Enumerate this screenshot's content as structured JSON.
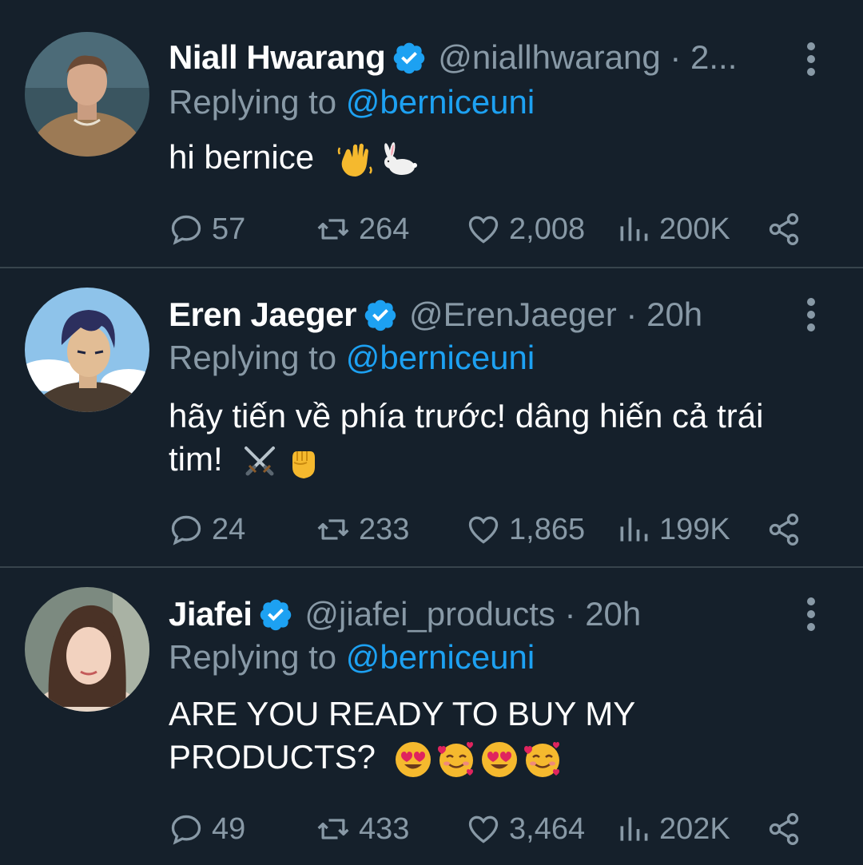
{
  "tweets": [
    {
      "name": "Niall Hwarang",
      "handle": "@niallhwarang · 2...",
      "reply_prefix": "Replying to ",
      "reply_mention": "@berniceuni",
      "text_lines": [
        "hi bernice"
      ],
      "emojis": [
        "waving-hand-emoji",
        "rabbit-emoji"
      ],
      "stats": {
        "replies": "57",
        "retweets": "264",
        "likes": "2,008",
        "views": "200K"
      }
    },
    {
      "name": "Eren Jaeger",
      "handle": "@ErenJaeger · 20h",
      "reply_prefix": "Replying to ",
      "reply_mention": "@berniceuni",
      "text_lines": [
        "hãy tiến về phía trước! dâng hiến cả trái",
        "tim!"
      ],
      "emojis": [
        "crossed-swords-emoji",
        "raised-fist-emoji"
      ],
      "stats": {
        "replies": "24",
        "retweets": "233",
        "likes": "1,865",
        "views": "199K"
      }
    },
    {
      "name": "Jiafei",
      "handle": "@jiafei_products · 20h",
      "reply_prefix": "Replying to ",
      "reply_mention": "@berniceuni",
      "text_lines": [
        "ARE YOU READY TO BUY MY",
        "PRODUCTS?"
      ],
      "emojis": [
        "heart-eyes-emoji",
        "smiling-face-with-hearts-emoji",
        "heart-eyes-emoji",
        "smiling-face-with-hearts-emoji"
      ],
      "stats": {
        "replies": "49",
        "retweets": "433",
        "likes": "3,464",
        "views": "202K"
      }
    }
  ],
  "colors": {
    "background": "#15202b",
    "divider": "#38444d",
    "secondary_text": "#8899a6",
    "mention": "#1da1f2",
    "verified": "#1da1f2"
  }
}
